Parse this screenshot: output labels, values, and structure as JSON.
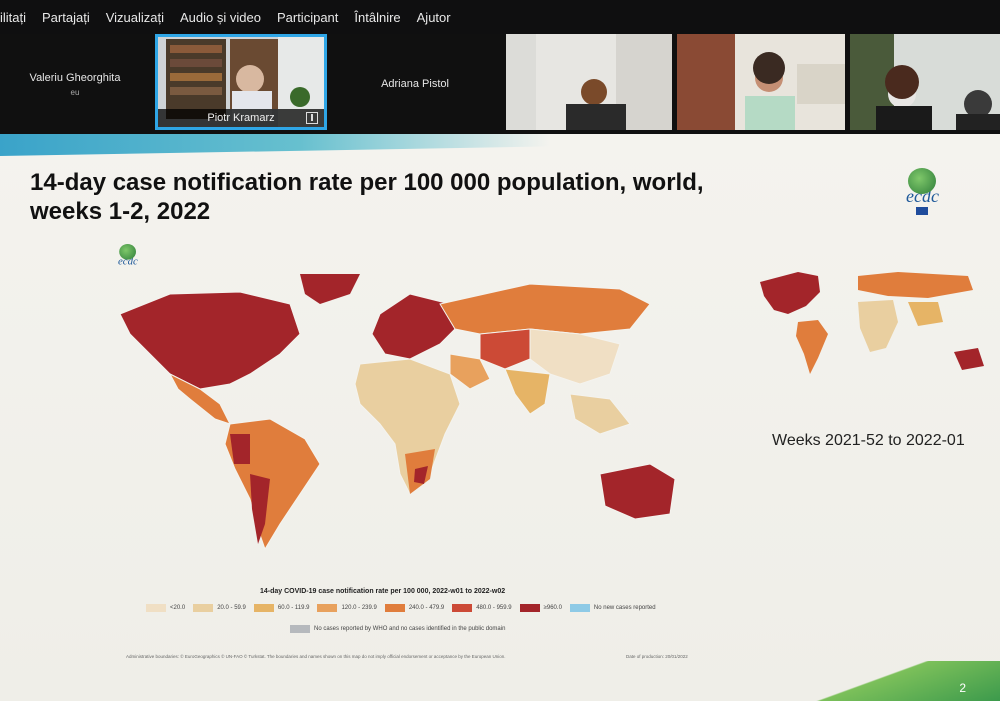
{
  "menu": {
    "items": [
      "ilitați",
      "Partajați",
      "Vizualizați",
      "Audio și video",
      "Participant",
      "Întâlnire",
      "Ajutor"
    ]
  },
  "participants": {
    "p1": {
      "name": "Valeriu Gheorghita",
      "sub": "eu"
    },
    "p2": {
      "name": "Piotr Kramarz"
    },
    "p3": {
      "name": "Adriana Pistol"
    }
  },
  "slide": {
    "title_line1": "14-day case notification rate per 100 000 population, world,",
    "title_line2": "weeks 1-2, 2022",
    "logo_text": "ecdc",
    "small_map_caption": "Weeks 2021-52 to 2022-01",
    "legend_title": "14-day COVID-19 case notification rate per 100 000, 2022-w01 to 2022-w02",
    "legend": [
      {
        "label": "<20.0",
        "color": "#f0dfc4"
      },
      {
        "label": "20.0 - 59.9",
        "color": "#e9cfa0"
      },
      {
        "label": "60.0 - 119.9",
        "color": "#e6b466"
      },
      {
        "label": "120.0 - 239.9",
        "color": "#e8a15d"
      },
      {
        "label": "240.0 - 479.9",
        "color": "#e07d3c"
      },
      {
        "label": "480.0 - 959.9",
        "color": "#cc4a36"
      },
      {
        "label": "≥960.0",
        "color": "#a3252a"
      },
      {
        "label": "No new cases reported",
        "color": "#8ecae6"
      }
    ],
    "legend_no_data": {
      "label": "No cases reported by WHO and no cases identified in the public domain",
      "color": "#b6b9bd"
    },
    "footer_note": "Administrative boundaries: © EuroGeographics © UN-FAO © Turkstat. The boundaries and names shown on this map do not imply official endorsement or acceptance by the European Union.",
    "footer_date": "Date of production: 20/01/2022",
    "page_number": "2"
  }
}
